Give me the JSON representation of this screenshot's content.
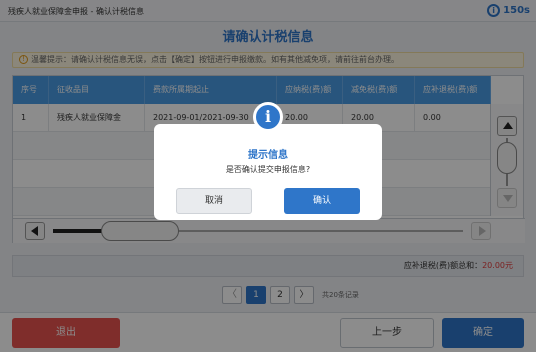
{
  "header": {
    "breadcrumb": "残疾人就业保障金申报  -  确认计税信息",
    "timer": "150s",
    "timer_icon": "info-circle-icon"
  },
  "page": {
    "title": "请确认计税信息"
  },
  "notice": {
    "icon": "warning-icon",
    "text": "温馨提示：请确认计税信息无误，点击【确定】按钮进行申报缴款。如有其他减免项，请前往前台办理。"
  },
  "table": {
    "columns": [
      "序号",
      "征收品目",
      "费款所属期起止",
      "应纳税(费)额",
      "减免税(费)额",
      "应补退税(费)额"
    ],
    "rows": [
      [
        "1",
        "残疾人就业保障金",
        "2021-09-01/2021-09-30",
        "20.00",
        "20.00",
        "0.00"
      ]
    ]
  },
  "totals": {
    "label": "应补退税(费)额总和：",
    "amount": "20.00元"
  },
  "pagination": {
    "prev": "〈",
    "pages": [
      "1",
      "2"
    ],
    "next": "〉",
    "info": "共20条记录"
  },
  "footer": {
    "exit_label": "退出",
    "prev_label": "上一步",
    "confirm_label": "确定"
  },
  "dialog": {
    "icon": "info-icon",
    "icon_glyph": "i",
    "title": "提示信息",
    "message": "是否确认提交申报信息?",
    "cancel_label": "取消",
    "ok_label": "确认"
  },
  "colors": {
    "primary": "#2f76c9",
    "header_blue": "#4a9be4",
    "danger": "#e8524f",
    "amount_red": "#e03b3b"
  }
}
